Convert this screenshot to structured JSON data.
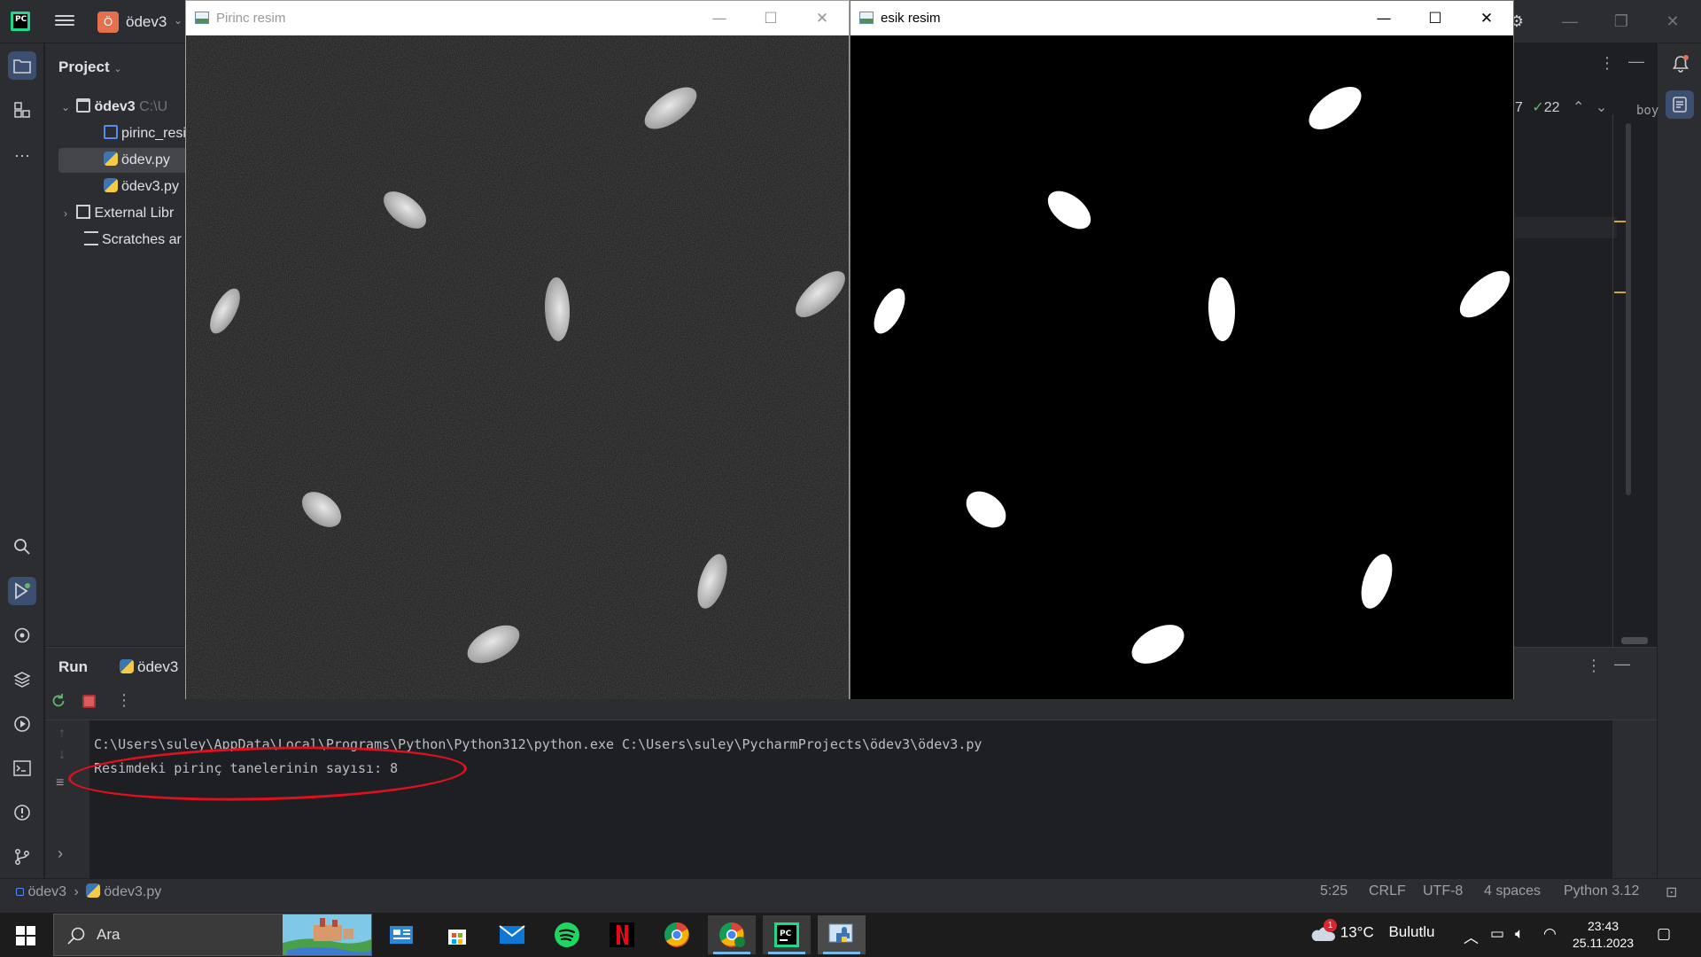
{
  "ide": {
    "project_badge": "Ö",
    "project_name": "ödev3",
    "project_panel_title": "Project",
    "tree": [
      {
        "label": "ödev3",
        "path": "C:\\U"
      },
      {
        "label": "pirinc_resi"
      },
      {
        "label": "ödev.py"
      },
      {
        "label": "ödev3.py"
      },
      {
        "label": "External Libr"
      },
      {
        "label": "Scratches ar"
      }
    ],
    "inspections": {
      "warnings": "7",
      "ok": "22"
    },
    "editor_snippet": "boy"
  },
  "run_panel": {
    "title": "Run",
    "tab": "ödev3",
    "console": [
      "C:\\Users\\suley\\AppData\\Local\\Programs\\Python\\Python312\\python.exe C:\\Users\\suley\\PycharmProjects\\ödev3\\ödev3.py",
      "Resimdeki pirinç tanelerinin sayısı: 8"
    ]
  },
  "status_bar": {
    "breadcrumb_project": "ödev3",
    "breadcrumb_file": "ödev3.py",
    "position": "5:25",
    "line_ending": "CRLF",
    "encoding": "UTF-8",
    "indent": "4 spaces",
    "interpreter": "Python 3.12"
  },
  "cv_windows": {
    "left_title": "Pirinc resim",
    "right_title": "esik resim",
    "grain_count": 8
  },
  "taskbar": {
    "search_placeholder": "Ara",
    "weather_temp": "13°C",
    "weather_desc": "Bulutlu",
    "weather_badge": "1",
    "time": "23:43",
    "date": "25.11.2023"
  },
  "colors": {
    "ide_bg": "#1e1f22",
    "ide_panel": "#2b2d30",
    "annotation": "#e0101f",
    "pycharm_green": "#21d789"
  }
}
